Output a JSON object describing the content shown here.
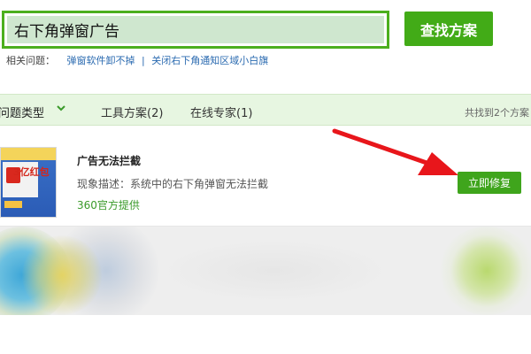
{
  "search": {
    "value": "右下角弹窗广告",
    "button_label": "查找方案"
  },
  "related": {
    "label": "相关问题：",
    "links": [
      "弹窗软件卸不掉",
      "关闭右下角通知区域小白旗"
    ],
    "separator": "|"
  },
  "tabs": {
    "type_label": "问题类型",
    "tools_label": "工具方案(2)",
    "experts_label": "在线专家(1)",
    "result_count": "共找到2个方案"
  },
  "result": {
    "title": "广告无法拦截",
    "description": "现象描述：系统中的右下角弹窗无法拦截",
    "provider": "360官方提供",
    "fix_label": "立即修复",
    "thumbnail_text": "3亿红包"
  },
  "colors": {
    "accent_green": "#42ab17",
    "tab_bar_bg": "#e7f6e1",
    "arrow_red": "#e8161b",
    "link_blue": "#2a6ab0"
  },
  "icons": {
    "tab_dropdown": "chevron-down-icon",
    "annotation": "red-arrow-icon"
  }
}
